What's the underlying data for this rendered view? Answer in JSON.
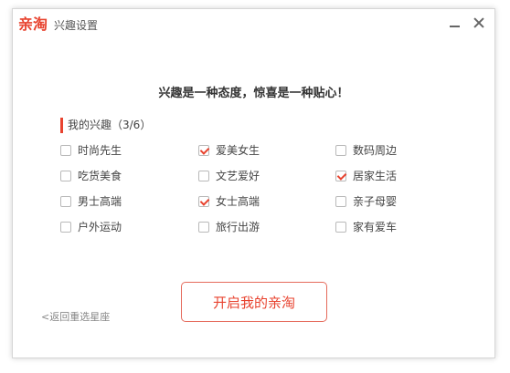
{
  "window": {
    "logo_text": "亲淘",
    "title": "兴趣设置",
    "minimize_icon": "minimize-icon",
    "close_icon": "close-icon"
  },
  "tagline": "兴趣是一种态度，惊喜是一种贴心！",
  "section": {
    "label": "我的兴趣（3/6）"
  },
  "interests": [
    {
      "label": "时尚先生",
      "checked": false
    },
    {
      "label": "爱美女生",
      "checked": true
    },
    {
      "label": "数码周边",
      "checked": false
    },
    {
      "label": "吃货美食",
      "checked": false
    },
    {
      "label": "文艺爱好",
      "checked": false
    },
    {
      "label": "居家生活",
      "checked": true
    },
    {
      "label": "男士高端",
      "checked": false
    },
    {
      "label": "女士高端",
      "checked": true
    },
    {
      "label": "亲子母婴",
      "checked": false
    },
    {
      "label": "户外运动",
      "checked": false
    },
    {
      "label": "旅行出游",
      "checked": false
    },
    {
      "label": "家有爱车",
      "checked": false
    }
  ],
  "buttons": {
    "start_label": "开启我的亲淘",
    "back_label": "<返回重选星座"
  },
  "colors": {
    "accent": "#e8432f",
    "border": "#d6d6d6"
  }
}
